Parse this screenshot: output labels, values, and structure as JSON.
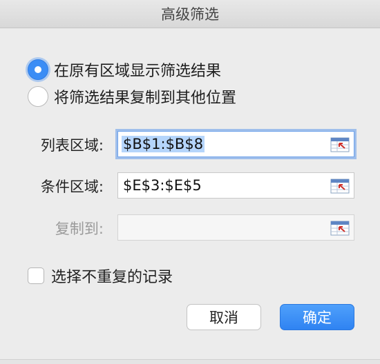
{
  "window": {
    "title": "高级筛选"
  },
  "options": {
    "in_place_label": "在原有区域显示筛选结果",
    "copy_to_label": "将筛选结果复制到其他位置",
    "selected": "in_place"
  },
  "fields": {
    "list_range": {
      "label": "列表区域:",
      "value": "$B$1:$B$8"
    },
    "criteria_range": {
      "label": "条件区域:",
      "value": "$E$3:$E$5"
    },
    "copy_to": {
      "label": "复制到:",
      "value": ""
    }
  },
  "unique_records": {
    "label": "选择不重复的记录",
    "checked": false
  },
  "buttons": {
    "cancel": "取消",
    "ok": "确定"
  },
  "colors": {
    "accent": "#3b8df5",
    "selection": "#b5d5fb"
  }
}
